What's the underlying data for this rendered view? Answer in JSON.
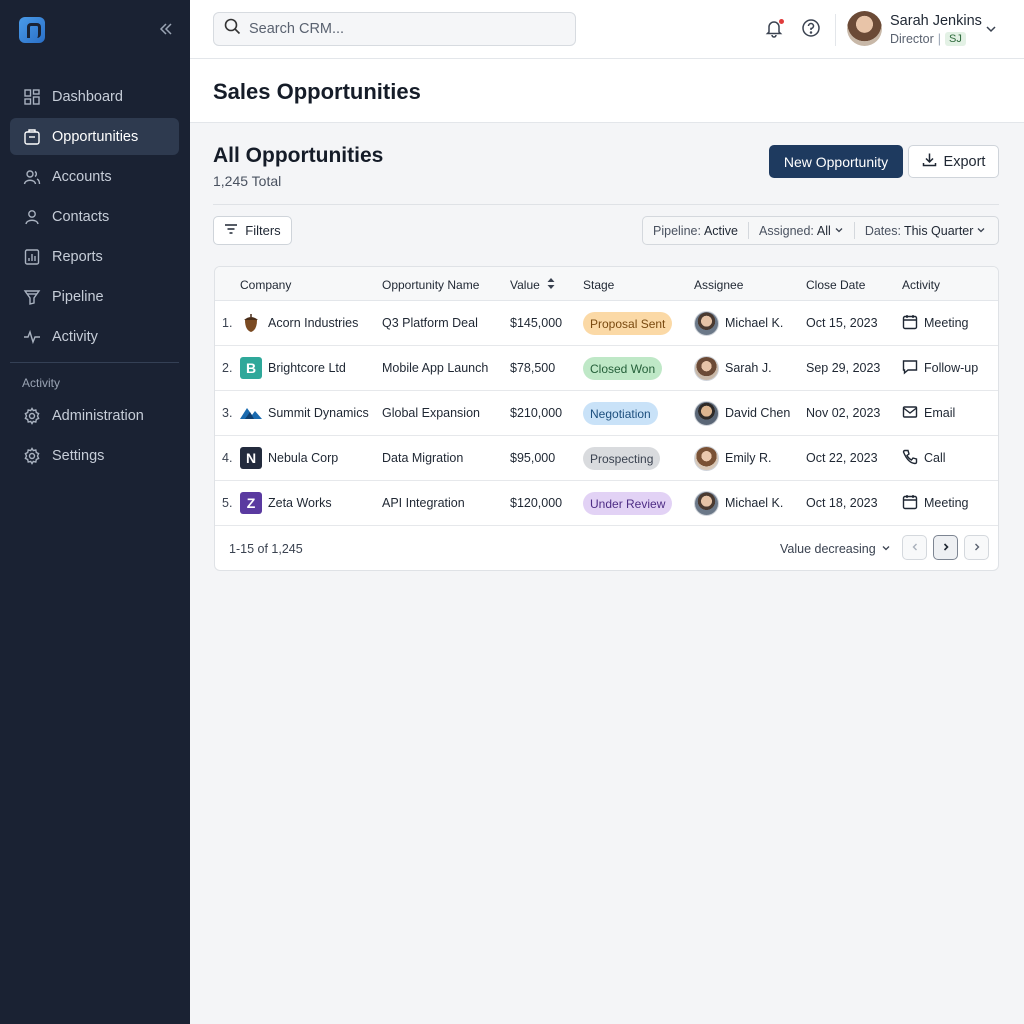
{
  "sidebar": {
    "items": [
      {
        "label": "Dashboard"
      },
      {
        "label": "Opportunities"
      },
      {
        "label": "Accounts"
      },
      {
        "label": "Contacts"
      },
      {
        "label": "Reports"
      },
      {
        "label": "Pipeline"
      },
      {
        "label": "Activity"
      }
    ],
    "section_label": "Activity",
    "secondary_items": [
      {
        "label": "Administration"
      },
      {
        "label": "Settings"
      }
    ]
  },
  "header": {
    "search_placeholder": "Search CRM...",
    "user_name": "Sarah Jenkins",
    "user_role": "Director",
    "user_initials": "SJ"
  },
  "page": {
    "title": "Sales Opportunities",
    "section_title": "All Opportunities",
    "total": "1,245 Total",
    "new_button": "New Opportunity",
    "export_button": "Export",
    "filters_button": "Filters",
    "filters": {
      "pipeline_label": "Pipeline:",
      "pipeline_value": "Active",
      "assigned_label": "Assigned:",
      "assigned_value": "All",
      "dates_label": "Dates:",
      "dates_value": "This Quarter"
    }
  },
  "table": {
    "columns": {
      "company": "Company",
      "opportunity": "Opportunity Name",
      "value": "Value",
      "stage": "Stage",
      "assignee": "Assignee",
      "close_date": "Close Date",
      "activity": "Activity"
    },
    "rows": [
      {
        "num": "1.",
        "company": "Acorn Industries",
        "opportunity": "Q3 Platform Deal",
        "value": "$145,000",
        "stage": "Proposal Sent",
        "assignee": "Michael K.",
        "close_date": "Oct 15, 2023",
        "activity": "Meeting",
        "activity_icon": "calendar-icon"
      },
      {
        "num": "2.",
        "company": "Brightcore Ltd",
        "opportunity": "Mobile App Launch",
        "value": "$78,500",
        "stage": "Closed Won",
        "assignee": "Sarah J.",
        "close_date": "Sep 29, 2023",
        "activity": "Follow-up",
        "activity_icon": "chat-icon"
      },
      {
        "num": "3.",
        "company": "Summit Dynamics",
        "opportunity": "Global Expansion",
        "value": "$210,000",
        "stage": "Negotiation",
        "assignee": "David Chen",
        "close_date": "Nov 02, 2023",
        "activity": "Email",
        "activity_icon": "mail-icon"
      },
      {
        "num": "4.",
        "company": "Nebula Corp",
        "opportunity": "Data Migration",
        "value": "$95,000",
        "stage": "Prospecting",
        "assignee": "Emily R.",
        "close_date": "Oct 22, 2023",
        "activity": "Call",
        "activity_icon": "phone-icon"
      },
      {
        "num": "5.",
        "company": "Zeta Works",
        "opportunity": "API Integration",
        "value": "$120,000",
        "stage": "Under Review",
        "assignee": "Michael K.",
        "close_date": "Oct 18, 2023",
        "activity": "Meeting",
        "activity_icon": "calendar-icon"
      }
    ],
    "logo_letters": [
      "",
      "B",
      "",
      "N",
      "Z"
    ],
    "footer_range": "1-15 of 1,245",
    "sort_label": "Value decreasing"
  },
  "colors": {
    "sidebar_bg": "#1a2233",
    "primary": "#1e3a5f",
    "stage_proposal": "#fbd9a6",
    "stage_won": "#bfe8c7",
    "stage_negotiation": "#c9e2f8",
    "stage_prospecting": "#d9dbde",
    "stage_review": "#e2d2f5"
  }
}
